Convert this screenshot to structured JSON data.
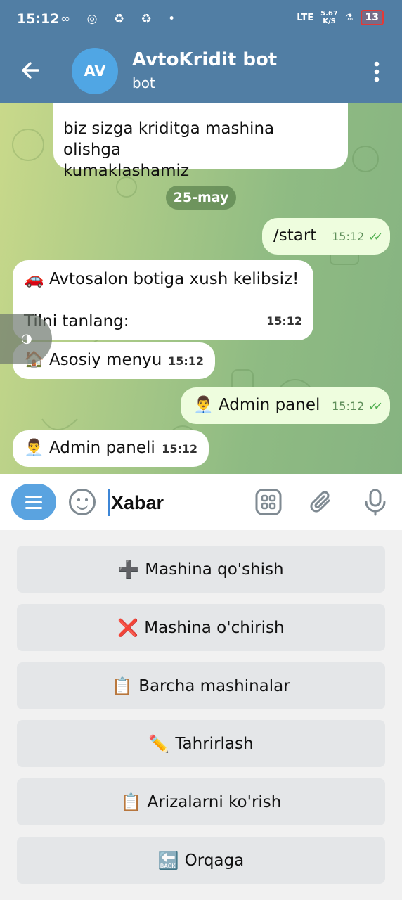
{
  "status_bar": {
    "time": "15:12",
    "icons": "∞ ◎ ♻ ♻ •",
    "net_speed_top": "5.67",
    "net_speed_bottom": "K/S",
    "lte": "LTE",
    "battery": "13"
  },
  "header": {
    "avatar_initials": "AV",
    "title": "AvtoKridit bot",
    "subtitle": "bot",
    "back_icon": "arrow-left-icon",
    "menu_icon": "more-vertical-icon"
  },
  "messages": [
    {
      "dir": "in",
      "text_line1": "biz sizga kriditga mashina olishga",
      "text_line2": "kumaklashamiz"
    },
    {
      "dir": "out",
      "text": "/start",
      "time": "15:12"
    },
    {
      "dir": "in",
      "emoji": "🚗",
      "text_line1": "Avtosalon botiga xush kelibsiz!",
      "text_line2": "Tilni tanlang:",
      "time": "15:12"
    },
    {
      "dir": "in",
      "emoji": "🏠",
      "text": "Asosiy menyu",
      "time": "15:12"
    },
    {
      "dir": "out",
      "emoji": "👨‍💼",
      "text": "Admin panel",
      "time": "15:12"
    },
    {
      "dir": "in",
      "emoji": "👨‍💼",
      "text": "Admin paneli",
      "time": "15:12"
    }
  ],
  "date_chip": "25-may",
  "side_handle_icon": "◑",
  "input": {
    "placeholder": "Xabar"
  },
  "keyboard": [
    {
      "icon": "➕",
      "label": "Mashina qo'shish"
    },
    {
      "icon": "❌",
      "label": "Mashina o'chirish"
    },
    {
      "icon": "📋",
      "label": "Barcha mashinalar"
    },
    {
      "icon": "✏️",
      "label": "Tahrirlash"
    },
    {
      "icon": "📋",
      "label": "Arizalarni ko'rish"
    },
    {
      "icon": "🔙",
      "label": "Orqaga"
    }
  ],
  "colors": {
    "header": "#517ea4",
    "accent": "#5aa3e0",
    "bubble_out": "#eefdde",
    "check": "#4fae4e"
  }
}
